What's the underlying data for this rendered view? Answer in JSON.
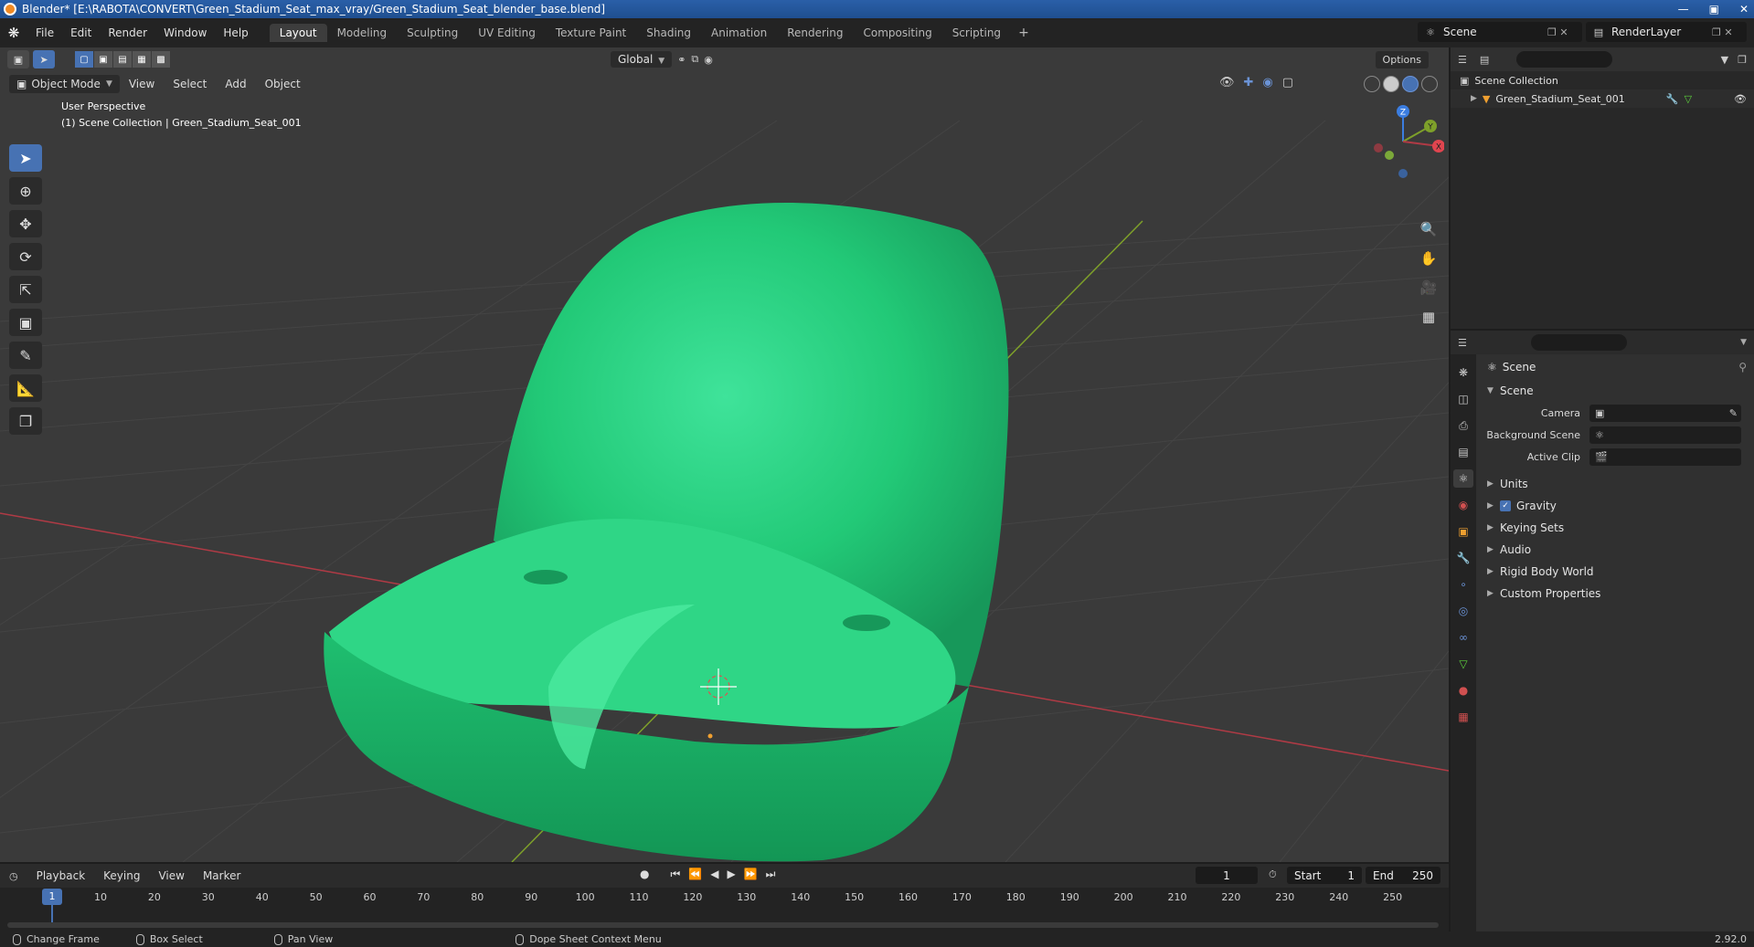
{
  "window": {
    "title": "Blender* [E:\\RABOTA\\CONVERT\\Green_Stadium_Seat_max_vray/Green_Stadium_Seat_blender_base.blend]"
  },
  "menubar": {
    "items": [
      "File",
      "Edit",
      "Render",
      "Window",
      "Help"
    ],
    "workspaces": [
      "Layout",
      "Modeling",
      "Sculpting",
      "UV Editing",
      "Texture Paint",
      "Shading",
      "Animation",
      "Rendering",
      "Compositing",
      "Scripting"
    ],
    "active_workspace": 0,
    "add_label": "+",
    "scene": "Scene",
    "render_layer": "RenderLayer"
  },
  "viewport": {
    "transform_orientation": "Global",
    "options_label": "Options",
    "mode": "Object Mode",
    "menus": [
      "View",
      "Select",
      "Add",
      "Object"
    ],
    "info_line1": "User Perspective",
    "info_line2": "(1) Scene Collection | Green_Stadium_Seat_001",
    "gizmo_axes": {
      "z": "Z",
      "y": "Y",
      "x": "X"
    },
    "colors": {
      "seat": "#22c977",
      "background": "#3a3a3a",
      "x_axis": "#b03a45",
      "y_axis": "#7ea02a"
    }
  },
  "outliner": {
    "search_placeholder": "",
    "root": "Scene Collection",
    "object": "Green_Stadium_Seat_001"
  },
  "properties": {
    "title": "Scene",
    "panel_scene": "Scene",
    "fields": [
      {
        "label": "Camera",
        "value": ""
      },
      {
        "label": "Background Scene",
        "value": ""
      },
      {
        "label": "Active Clip",
        "value": ""
      }
    ],
    "panels": [
      "Units",
      "Gravity",
      "Keying Sets",
      "Audio",
      "Rigid Body World",
      "Custom Properties"
    ]
  },
  "timeline": {
    "menus": [
      "Playback",
      "Keying",
      "View",
      "Marker"
    ],
    "current_frame": "1",
    "start_label": "Start",
    "start": "1",
    "end_label": "End",
    "end": "250",
    "ticks": [
      "10",
      "20",
      "30",
      "40",
      "50",
      "60",
      "70",
      "80",
      "90",
      "100",
      "110",
      "120",
      "130",
      "140",
      "150",
      "160",
      "170",
      "180",
      "190",
      "200",
      "210",
      "220",
      "230",
      "240",
      "250"
    ],
    "frame_marker": "1"
  },
  "statusbar": {
    "items": [
      "Change Frame",
      "Box Select",
      "Pan View",
      "Dope Sheet Context Menu"
    ],
    "version": "2.92.0"
  }
}
